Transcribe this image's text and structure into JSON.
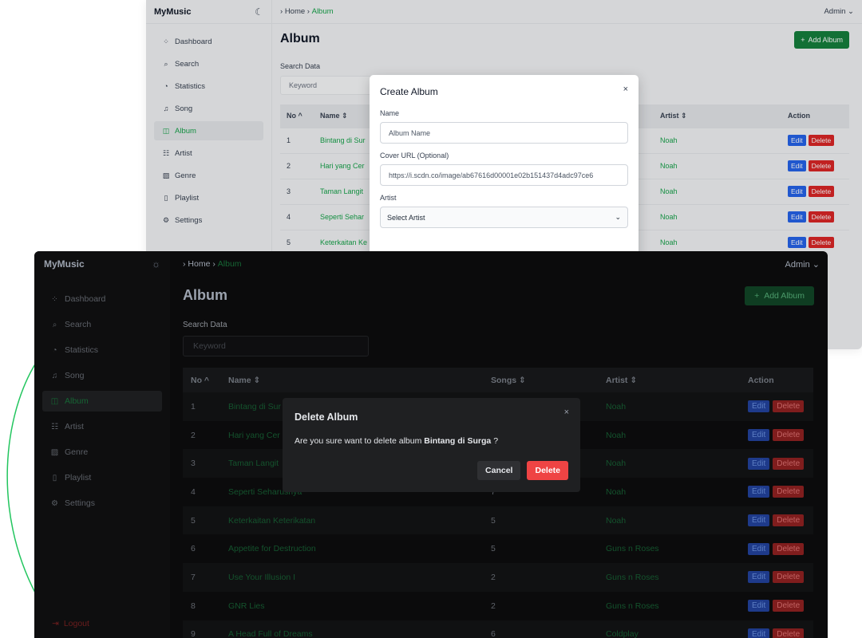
{
  "light": {
    "brand": "MyMusic",
    "nav": [
      {
        "label": "Dashboard",
        "icon": "dashboard-icon",
        "glyph": "⁘"
      },
      {
        "label": "Search",
        "icon": "search-icon",
        "glyph": "⌕"
      },
      {
        "label": "Statistics",
        "icon": "chart-pie-icon",
        "glyph": "◔"
      },
      {
        "label": "Song",
        "icon": "music-note-icon",
        "glyph": "♫"
      },
      {
        "label": "Album",
        "icon": "album-icon",
        "glyph": "◫"
      },
      {
        "label": "Artist",
        "icon": "artist-icon",
        "glyph": "☷"
      },
      {
        "label": "Genre",
        "icon": "genre-icon",
        "glyph": "▨"
      },
      {
        "label": "Playlist",
        "icon": "bookmark-icon",
        "glyph": "▯"
      },
      {
        "label": "Settings",
        "icon": "gear-icon",
        "glyph": "⚙"
      }
    ],
    "breadcrumb": {
      "home": "Home",
      "current": "Album"
    },
    "admin": "Admin",
    "page_title": "Album",
    "add_label": "Add Album",
    "search_label": "Search Data",
    "search_placeholder": "Keyword",
    "headers": {
      "no": "No",
      "name": "Name",
      "artist": "Artist",
      "action": "Action"
    },
    "rows": [
      {
        "no": "1",
        "name": "Bintang di Sur",
        "artist": "Noah"
      },
      {
        "no": "2",
        "name": "Hari yang Cer",
        "artist": "Noah"
      },
      {
        "no": "3",
        "name": "Taman Langit",
        "artist": "Noah"
      },
      {
        "no": "4",
        "name": "Seperti Sehar",
        "artist": "Noah"
      },
      {
        "no": "5",
        "name": "Keterkaitan Ke",
        "artist": "Noah"
      }
    ],
    "edit": "Edit",
    "delete": "Delete",
    "modal": {
      "title": "Create Album",
      "close": "×",
      "name_label": "Name",
      "name_placeholder": "Album Name",
      "cover_label": "Cover URL (Optional)",
      "cover_value": "https://i.scdn.co/image/ab67616d00001e02b151437d4adc97ce6",
      "artist_label": "Artist",
      "artist_value": "Select Artist"
    }
  },
  "dark": {
    "brand": "MyMusic",
    "nav": [
      {
        "label": "Dashboard",
        "icon": "dashboard-icon",
        "glyph": "⁘"
      },
      {
        "label": "Search",
        "icon": "search-icon",
        "glyph": "⌕"
      },
      {
        "label": "Statistics",
        "icon": "chart-pie-icon",
        "glyph": "◔"
      },
      {
        "label": "Song",
        "icon": "music-note-icon",
        "glyph": "♫"
      },
      {
        "label": "Album",
        "icon": "album-icon",
        "glyph": "◫"
      },
      {
        "label": "Artist",
        "icon": "artist-icon",
        "glyph": "☷"
      },
      {
        "label": "Genre",
        "icon": "genre-icon",
        "glyph": "▨"
      },
      {
        "label": "Playlist",
        "icon": "bookmark-icon",
        "glyph": "▯"
      },
      {
        "label": "Settings",
        "icon": "gear-icon",
        "glyph": "⚙"
      }
    ],
    "logout": "Logout",
    "breadcrumb": {
      "home": "Home",
      "current": "Album"
    },
    "admin": "Admin",
    "page_title": "Album",
    "add_label": "Add Album",
    "search_label": "Search Data",
    "search_placeholder": "Keyword",
    "headers": {
      "no": "No",
      "name": "Name",
      "songs": "Songs",
      "artist": "Artist",
      "action": "Action"
    },
    "rows": [
      {
        "no": "1",
        "name": "Bintang di Sur",
        "songs": "",
        "artist": "Noah"
      },
      {
        "no": "2",
        "name": "Hari yang Cer",
        "songs": "",
        "artist": "Noah"
      },
      {
        "no": "3",
        "name": "Taman Langit",
        "songs": "",
        "artist": "Noah"
      },
      {
        "no": "4",
        "name": "Seperti Seharusnya",
        "songs": "7",
        "artist": "Noah"
      },
      {
        "no": "5",
        "name": "Keterkaitan Keterikatan",
        "songs": "5",
        "artist": "Noah"
      },
      {
        "no": "6",
        "name": "Appetite for Destruction",
        "songs": "5",
        "artist": "Guns n Roses"
      },
      {
        "no": "7",
        "name": "Use Your Illusion I",
        "songs": "2",
        "artist": "Guns n Roses"
      },
      {
        "no": "8",
        "name": "GNR Lies",
        "songs": "2",
        "artist": "Guns n Roses"
      },
      {
        "no": "9",
        "name": "A Head Full of Dreams",
        "songs": "6",
        "artist": "Coldplay"
      }
    ],
    "edit": "Edit",
    "delete": "Delete",
    "modal": {
      "title": "Delete Album",
      "close": "×",
      "message_prefix": "Are you sure want to delete album",
      "album": "Bintang di Surga",
      "message_suffix": "?",
      "cancel": "Cancel",
      "confirm": "Delete"
    }
  },
  "colors": {
    "accent": "#16a34a",
    "danger": "#dc2626",
    "edit": "#2563eb"
  }
}
